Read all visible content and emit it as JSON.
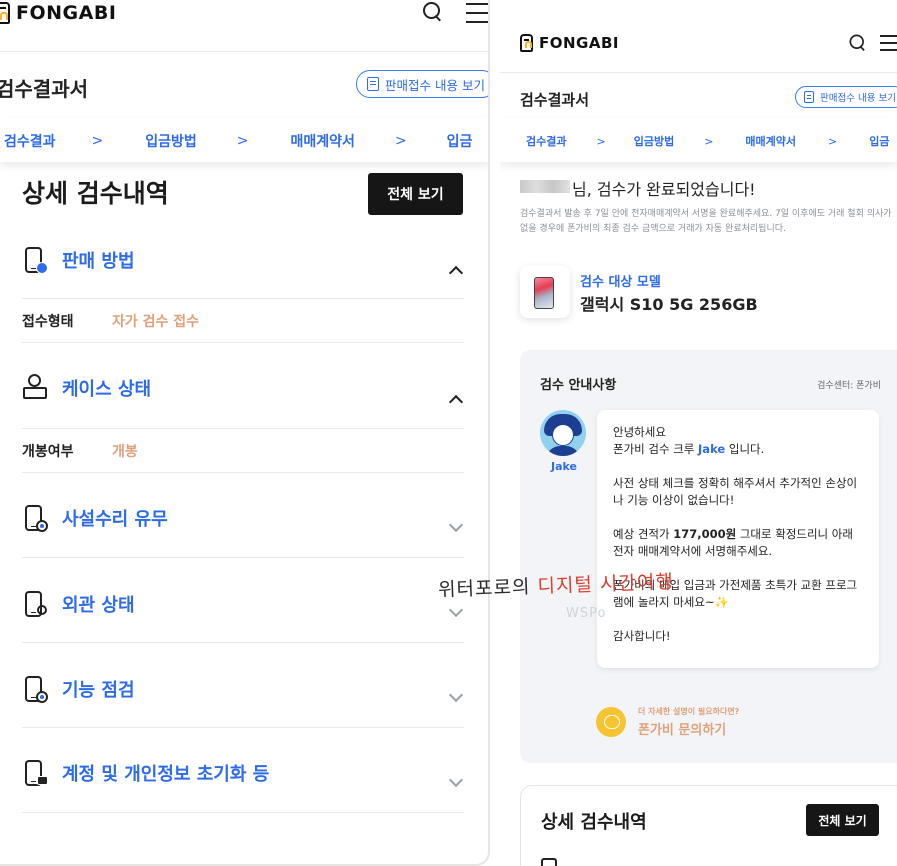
{
  "brand": {
    "name": "FONGABI"
  },
  "left": {
    "page_title": "검수결과서",
    "sales_receipt_button": "판매접수 내용 보기",
    "steps": [
      "검수결과",
      "입금방법",
      "매매계약서",
      "입금"
    ],
    "step_arrow": ">",
    "detail_title": "상세 검수내역",
    "view_all_button": "전체 보기",
    "sections": [
      {
        "label": "판매 방법",
        "icon": "phone-check-icon",
        "expanded": true,
        "row": {
          "key": "접수형태",
          "value": "자가 검수 접수"
        }
      },
      {
        "label": "케이스 상태",
        "icon": "box-coin-icon",
        "expanded": true,
        "row": {
          "key": "개봉여부",
          "value": "개봉"
        }
      },
      {
        "label": "사설수리 유무",
        "icon": "phone-gear-icon",
        "expanded": false
      },
      {
        "label": "외관 상태",
        "icon": "phone-search-icon",
        "expanded": false
      },
      {
        "label": "기능 점검",
        "icon": "phone-gear-icon",
        "expanded": false
      },
      {
        "label": "계정 및 개인정보 초기화 등",
        "icon": "phone-lock-icon",
        "expanded": false
      }
    ]
  },
  "right": {
    "page_title": "검수결과서",
    "sales_receipt_button": "판매접수 내용 보기",
    "steps": [
      "검수결과",
      "입금방법",
      "매매계약서",
      "입금"
    ],
    "step_arrow": ">",
    "done_message": "님, 검수가 완료되었습니다!",
    "notice": "검수결과서 발송 후 7일 안에 전자매매계약서 서명을 완료해주세요. 7일 이후에도 거래 철회 의사가 없을 경우에 폰가비의 최종 검수 금액으로 거래가 자동 완료처리됩니다.",
    "model_label": "검수 대상 모델",
    "model_name": "갤럭시 S10 5G 256GB",
    "guide": {
      "title": "검수 안내사항",
      "center": "검수센터: 폰가비",
      "avatar_name": "Jake",
      "line1": "안녕하세요",
      "line2_pre": "폰가비 검수 크루 ",
      "line2_name": "Jake",
      "line2_post": " 입니다.",
      "para2": "사전 상태 체크를 정확히 해주셔서 추가적인 손상이나 기능 이상이 없습니다!",
      "para3_pre": "예상 견적가 ",
      "para3_price": "177,000원",
      "para3_post": " 그대로 확정드리니 아래 전자 매매계약서에 서명해주세요.",
      "para4": "폰가비의 매입 입금과 가전제품 초특가 교환 프로그램에 놀라지 마세요~",
      "sparkle": "✨",
      "thanks": "감사합니다!"
    },
    "ask_small": "더 자세한 설명이 필요하다면?",
    "ask_big": "폰가비 문의하기",
    "detail_title": "상세 검수내역",
    "view_all_button": "전체 보기"
  },
  "watermark": {
    "part1": "위터포로의 ",
    "part2": "디지털 시간여행",
    "sub": "WSPo"
  },
  "colors": {
    "accent": "#2d6be8",
    "value_tan": "#e0a07a",
    "dark_button": "#161616",
    "guide_bg": "#f2f4f7"
  }
}
